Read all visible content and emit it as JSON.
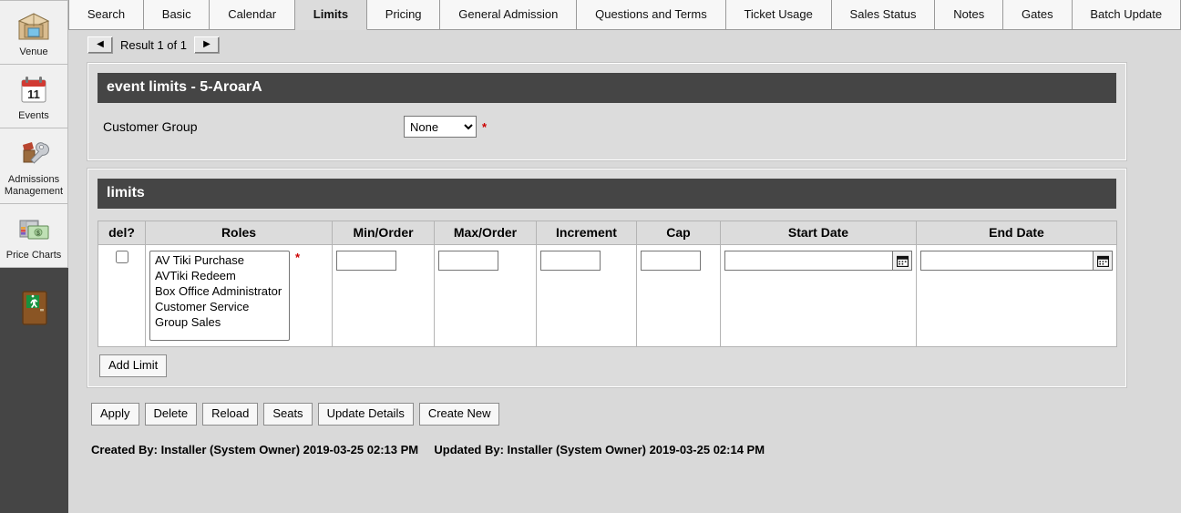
{
  "sidebar": {
    "items": [
      {
        "label": "Venue",
        "icon": "venue-box-icon"
      },
      {
        "label": "Events",
        "icon": "calendar-icon",
        "day": "11"
      },
      {
        "label": "Admissions Management",
        "icon": "admissions-wrench-icon"
      },
      {
        "label": "Price Charts",
        "icon": "money-chart-icon"
      }
    ],
    "exit": {
      "label": "",
      "icon": "exit-door-icon"
    }
  },
  "tabs": [
    {
      "label": "Search",
      "active": false
    },
    {
      "label": "Basic",
      "active": false
    },
    {
      "label": "Calendar",
      "active": false
    },
    {
      "label": "Limits",
      "active": true
    },
    {
      "label": "Pricing",
      "active": false
    },
    {
      "label": "General Admission",
      "active": false
    },
    {
      "label": "Questions and Terms",
      "active": false
    },
    {
      "label": "Ticket Usage",
      "active": false
    },
    {
      "label": "Sales Status",
      "active": false
    },
    {
      "label": "Notes",
      "active": false
    },
    {
      "label": "Gates",
      "active": false
    },
    {
      "label": "Batch Update",
      "active": false
    }
  ],
  "result_nav": {
    "prev_icon": "◀",
    "next_icon": "▶",
    "label": "Result 1 of 1"
  },
  "event_panel": {
    "title": "event limits - 5-AroarA",
    "customer_group_label": "Customer Group",
    "customer_group_value": "None",
    "customer_group_options": [
      "None"
    ],
    "required_marker": "*"
  },
  "limits_panel": {
    "title": "limits",
    "columns": [
      "del?",
      "Roles",
      "Min/Order",
      "Max/Order",
      "Increment",
      "Cap",
      "Start Date",
      "End Date"
    ],
    "row": {
      "del_checked": false,
      "roles_options": [
        "AV Tiki Purchase",
        "AVTiki Redeem",
        "Box Office Administrator",
        "Customer Service",
        "Group Sales"
      ],
      "roles_required_marker": "*",
      "min_order": "",
      "max_order": "",
      "increment": "",
      "cap": "",
      "start_date": "",
      "end_date": "",
      "date_button_icon": "calendar-icon"
    },
    "add_limit_label": "Add Limit"
  },
  "actions": [
    {
      "label": "Apply"
    },
    {
      "label": "Delete"
    },
    {
      "label": "Reload"
    },
    {
      "label": "Seats"
    },
    {
      "label": "Update Details"
    },
    {
      "label": "Create New"
    }
  ],
  "footer": {
    "created": "Created By: Installer (System Owner) 2019-03-25 02:13 PM",
    "updated": "Updated By: Installer (System Owner) 2019-03-25 02:14 PM"
  },
  "colors": {
    "dark_header": "#454545",
    "panel_bg": "#dcdcdc",
    "page_bg": "#d9d9d9",
    "required": "#cc0000",
    "active_tab": "#dcdcdc"
  }
}
